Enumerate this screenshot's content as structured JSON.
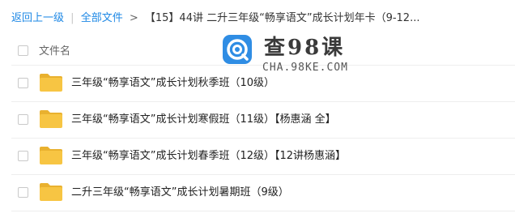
{
  "breadcrumb": {
    "back_label": "返回上一级",
    "separator": "|",
    "all_files_label": "全部文件",
    "arrow": ">",
    "current_folder": "【15】44讲 二升三年级“畅享语文”成长计划年卡（9-12..."
  },
  "table": {
    "column_name": "文件名"
  },
  "files": [
    {
      "name": "三年级“畅享语文”成长计划秋季班（10级）",
      "icon": "folder-icon"
    },
    {
      "name": "三年级“畅享语文”成长计划寒假班（11级）【杨惠涵 全】",
      "icon": "folder-icon"
    },
    {
      "name": "三年级“畅享语文”成长计划春季班（12级）【12讲杨惠涵】",
      "icon": "folder-icon"
    },
    {
      "name": "二升三年级“畅享语文”成长计划暑期班（9级）",
      "icon": "folder-icon"
    }
  ],
  "watermark": {
    "title": "查98课",
    "subtitle": "CHA.98KE.COM"
  },
  "colors": {
    "link": "#1e88e5",
    "folder": "#f7c543",
    "folder_tab": "#e9b12f",
    "logo": "#2f8de4"
  }
}
